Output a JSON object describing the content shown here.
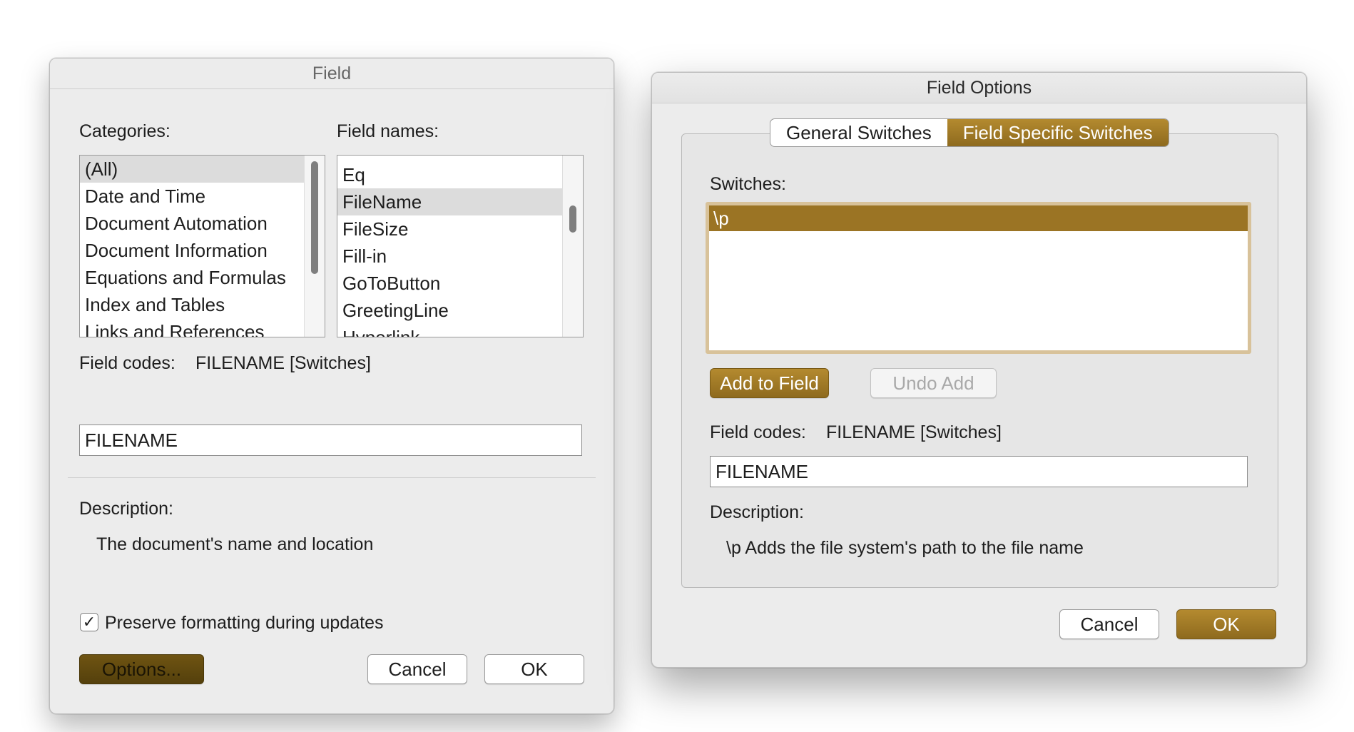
{
  "field_dialog": {
    "title": "Field",
    "categories_label": "Categories:",
    "categories": [
      "(All)",
      "Date and Time",
      "Document Automation",
      "Document Information",
      "Equations and Formulas",
      "Index and Tables",
      "Links and References"
    ],
    "field_names_label": "Field names:",
    "field_names": [
      "Eq",
      "FileName",
      "FileSize",
      "Fill-in",
      "GoToButton",
      "GreetingLine",
      "Hyperlink"
    ],
    "field_codes_label": "Field codes:",
    "field_codes_value": "FILENAME [Switches]",
    "field_input_value": "FILENAME",
    "description_label": "Description:",
    "description_text": "The document's name and location",
    "preserve_label": "Preserve formatting during updates",
    "preserve_checked": "✓",
    "options_button": "Options...",
    "cancel_button": "Cancel",
    "ok_button": "OK"
  },
  "options_dialog": {
    "title": "Field Options",
    "tabs": [
      "General Switches",
      "Field Specific Switches"
    ],
    "switches_label": "Switches:",
    "switches": [
      "\\p"
    ],
    "add_button": "Add to Field",
    "undo_button": "Undo Add",
    "field_codes_label": "Field codes:",
    "field_codes_value": "FILENAME [Switches]",
    "field_input_value": "FILENAME",
    "description_label": "Description:",
    "description_text": "\\p Adds the file system's path to the file name",
    "cancel_button": "Cancel",
    "ok_button": "OK"
  },
  "colors": {
    "accent": "#9b7424",
    "options_button": "#5f4810"
  }
}
